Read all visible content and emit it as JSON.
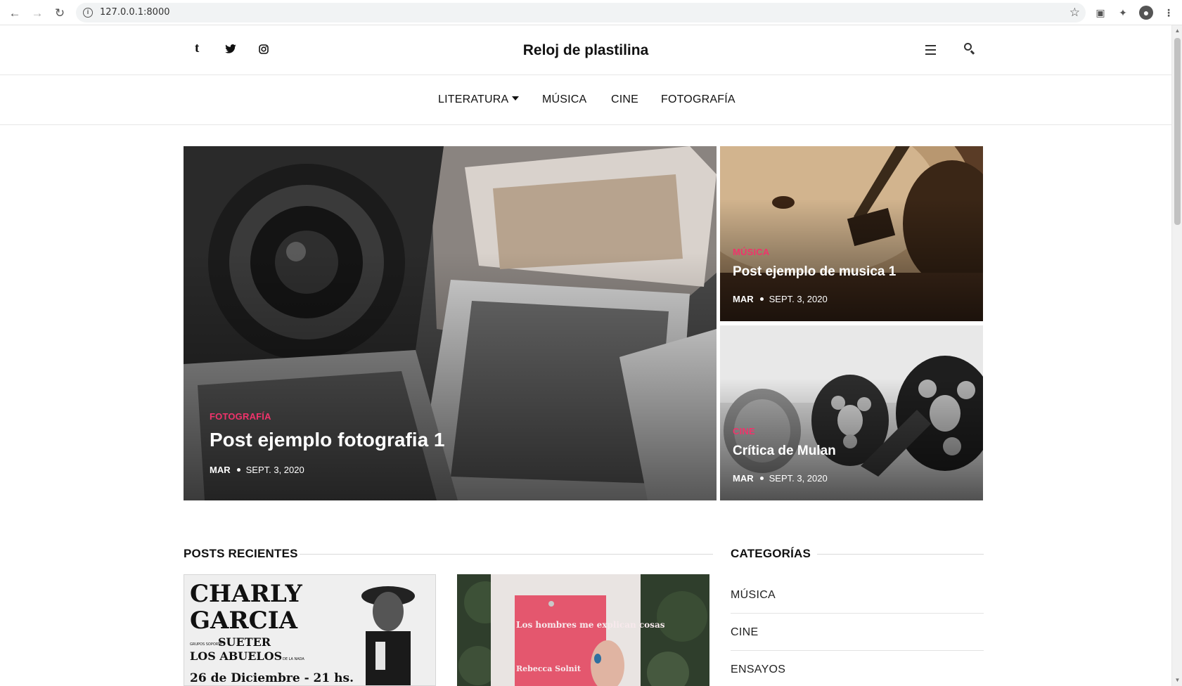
{
  "browser": {
    "url": "127.0.0.1:8000"
  },
  "site": {
    "title": "Reloj de plastilina",
    "social": {
      "tumblr": "t"
    }
  },
  "nav": {
    "items": [
      "LITERATURA",
      "MÚSICA",
      "CINE",
      "FOTOGRAFÍA"
    ]
  },
  "featured": [
    {
      "category": "FOTOGRAFÍA",
      "title": "Post ejemplo fotografia 1",
      "author": "MAR",
      "date": "SEPT. 3, 2020"
    },
    {
      "category": "MÚSICA",
      "title": "Post ejemplo de musica 1",
      "author": "MAR",
      "date": "SEPT. 3, 2020"
    },
    {
      "category": "CINE",
      "title": "Crítica de Mulan",
      "author": "MAR",
      "date": "SEPT. 3, 2020"
    }
  ],
  "recent": {
    "heading": "POSTS RECIENTES",
    "thumb1": {
      "line1": "CHARLY",
      "line2": "GARCIA",
      "support_label": "GRUPOS SOPORTE",
      "band1": "SUETER",
      "band2": "LOS ABUELOS",
      "band2_suffix": "DE LA NADA",
      "date": "26 de Diciembre - 21 hs."
    },
    "thumb2": {
      "book_title": "Los hombres me explican cosas",
      "book_author": "Rebecca Solnit"
    }
  },
  "categories": {
    "heading": "CATEGORÍAS",
    "items": [
      "MÚSICA",
      "CINE",
      "ENSAYOS"
    ]
  }
}
